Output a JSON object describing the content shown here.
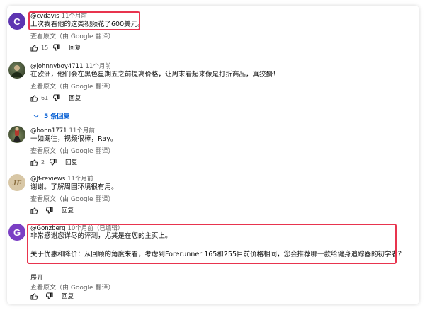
{
  "colors": {
    "accent": "#065fd4",
    "highlight": "#e8344e"
  },
  "comments": [
    {
      "avatar_letter": "C",
      "avatar_color": "#5e35b1",
      "author": "@cvdavis",
      "time": "11个月前",
      "text": "上次我看他的这类视频花了600美元。",
      "translate": "查看原文（由 Google 翻译）",
      "likes": "15",
      "reply_label": "回复"
    },
    {
      "avatar_letter": "",
      "avatar_color": "#3f4a2e",
      "author": "@johnnyboy4711",
      "time": "11个月前",
      "text": "在欧洲，他们会在黑色星期五之前提高价格，让周末看起来像是打折商品，真狡猾！",
      "translate": "查看原文（由 Google 翻译）",
      "likes": "61",
      "reply_label": "回复",
      "replies_label": "5 条回复"
    },
    {
      "avatar_letter": "",
      "avatar_color": "#4b5d3a",
      "author": "@bonn1771",
      "time": "11个月前",
      "text": "一如既往，视频很棒，Ray。",
      "translate": "查看原文（由 Google 翻译）",
      "likes": "2",
      "reply_label": "回复"
    },
    {
      "avatar_letter": "",
      "avatar_color": "#d8c7a6",
      "author": "@Jf-reviews",
      "time": "11个月前",
      "text": "谢谢。了解周围环境很有用。",
      "translate": "查看原文（由 Google 翻译）",
      "likes": "",
      "reply_label": "回复"
    },
    {
      "avatar_letter": "G",
      "avatar_color": "#7b3fc4",
      "author": "@Gonzberg",
      "time": "10个月前（已编辑）",
      "text_lines": [
        "非常感谢您详尽的评测，尤其是在您的主页上。",
        "",
        "关于优惠和降价：从回顾的角度来看，考虑到Forerunner 165和255目前价格相同，您会推荐哪一款给健身追踪器的初学者？"
      ],
      "expand_label": "展开",
      "translate": "查看原文（由 Google 翻译）",
      "likes": "",
      "reply_label": "回复"
    }
  ]
}
